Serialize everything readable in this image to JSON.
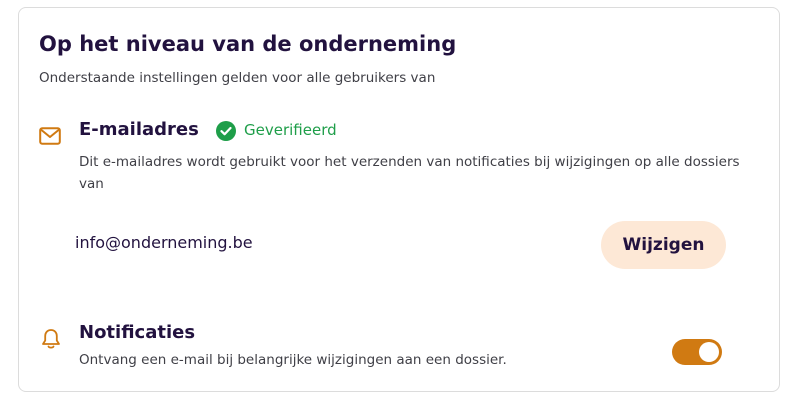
{
  "section": {
    "title": "Op het niveau van de onderneming",
    "subtitle": "Onderstaande instellingen gelden voor alle gebruikers van"
  },
  "email": {
    "icon": "envelope-icon",
    "title": "E-mailadres",
    "verified_icon": "check-circle-icon",
    "verified_label": "Geverifieerd",
    "description": "Dit e-mailadres wordt gebruikt voor het verzenden van notificaties bij wijzigingen op alle dossiers van",
    "value": "info@onderneming.be",
    "change_label": "Wijzigen"
  },
  "notifications": {
    "icon": "bell-icon",
    "title": "Notificaties",
    "description": "Ontvang een e-mail bij belangrijke wijzigingen aan een dossier.",
    "enabled": true
  },
  "colors": {
    "accent": "#d07a12",
    "heading": "#22123f",
    "verified": "#1e9e49",
    "button_bg": "#fde8d6"
  }
}
